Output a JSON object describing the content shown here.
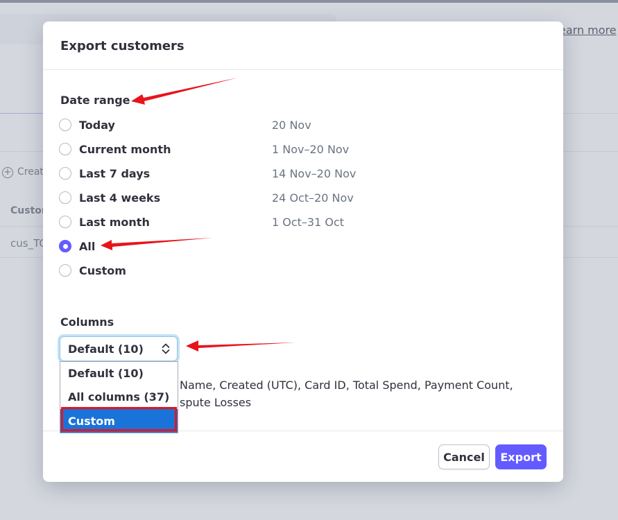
{
  "background": {
    "learn_more_link": "earn more",
    "create_button": "Creat",
    "table_column_header": "Custom",
    "table_cell_id": "cus_TC"
  },
  "modal": {
    "title": "Export customers",
    "date_range": {
      "label": "Date range",
      "selected": "All",
      "options": [
        {
          "label": "Today",
          "range": "20 Nov"
        },
        {
          "label": "Current month",
          "range": "1 Nov–20 Nov"
        },
        {
          "label": "Last 7 days",
          "range": "14 Nov–20 Nov"
        },
        {
          "label": "Last 4 weeks",
          "range": "24 Oct–20 Nov"
        },
        {
          "label": "Last month",
          "range": "1 Oct–31 Oct"
        },
        {
          "label": "All",
          "range": ""
        },
        {
          "label": "Custom",
          "range": ""
        }
      ]
    },
    "columns": {
      "label": "Columns",
      "select_value": "Default (10)",
      "description_line1": "Name, Created (UTC), Card ID, Total Spend, Payment Count,",
      "description_line2": "spute Losses",
      "dropdown_options": [
        "Default (10)",
        "All columns (37)",
        "Custom"
      ],
      "dropdown_highlighted": "Custom"
    },
    "footer": {
      "cancel_label": "Cancel",
      "export_label": "Export"
    }
  },
  "colors": {
    "accent": "#635bff",
    "dropdown_highlight": "#1a73d9",
    "annotation_red": "#e8141b"
  }
}
